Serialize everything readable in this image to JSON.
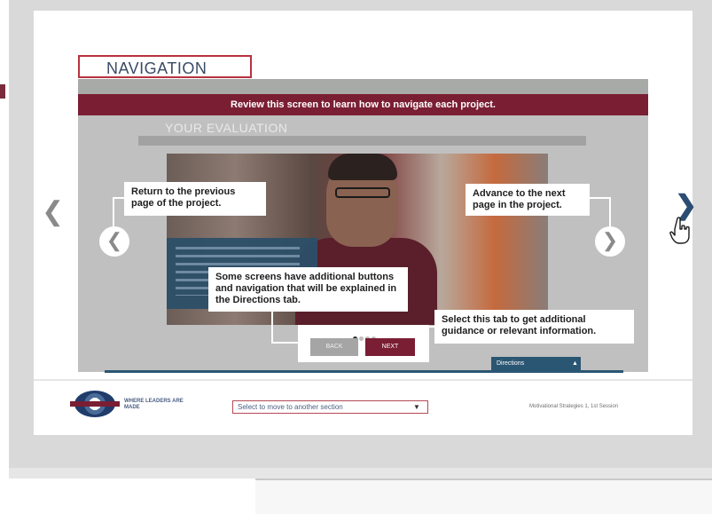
{
  "module": {
    "title": "NAVIGATION",
    "banner": "Review this screen to learn how to navigate each project.",
    "evaluation_title": "YOUR EVALUATION"
  },
  "callouts": {
    "previous": "Return to the previous page of the project.",
    "next": "Advance to the next page in the project.",
    "additional": "Some screens have additional buttons and navigation that will be explained in the Directions tab.",
    "tab_info": "Select this tab to get additional guidance or relevant information."
  },
  "controls": {
    "prev_circle_glyph": "❮",
    "next_circle_glyph": "❯",
    "edge_prev_glyph": "❮",
    "edge_next_glyph": "❯",
    "back_label": "BACK",
    "next_label": "NEXT",
    "page_dots": 4,
    "active_dot": 1
  },
  "directions_tab": {
    "label": "Directions",
    "arrow": "▲"
  },
  "footer": {
    "logo_tagline": "WHERE LEADERS ARE MADE",
    "section_select_value": "Select to move to another section",
    "select_arrow": "▼",
    "course_name": "Motivational Strategies 1, 1st Session"
  },
  "icons": {
    "cursor": "hand-pointer-icon",
    "prev": "chevron-left-icon",
    "next": "chevron-right-icon"
  },
  "colors": {
    "brand_maroon": "#7a1e33",
    "directions_blue": "#2b5673",
    "title_border": "#b8323f"
  }
}
